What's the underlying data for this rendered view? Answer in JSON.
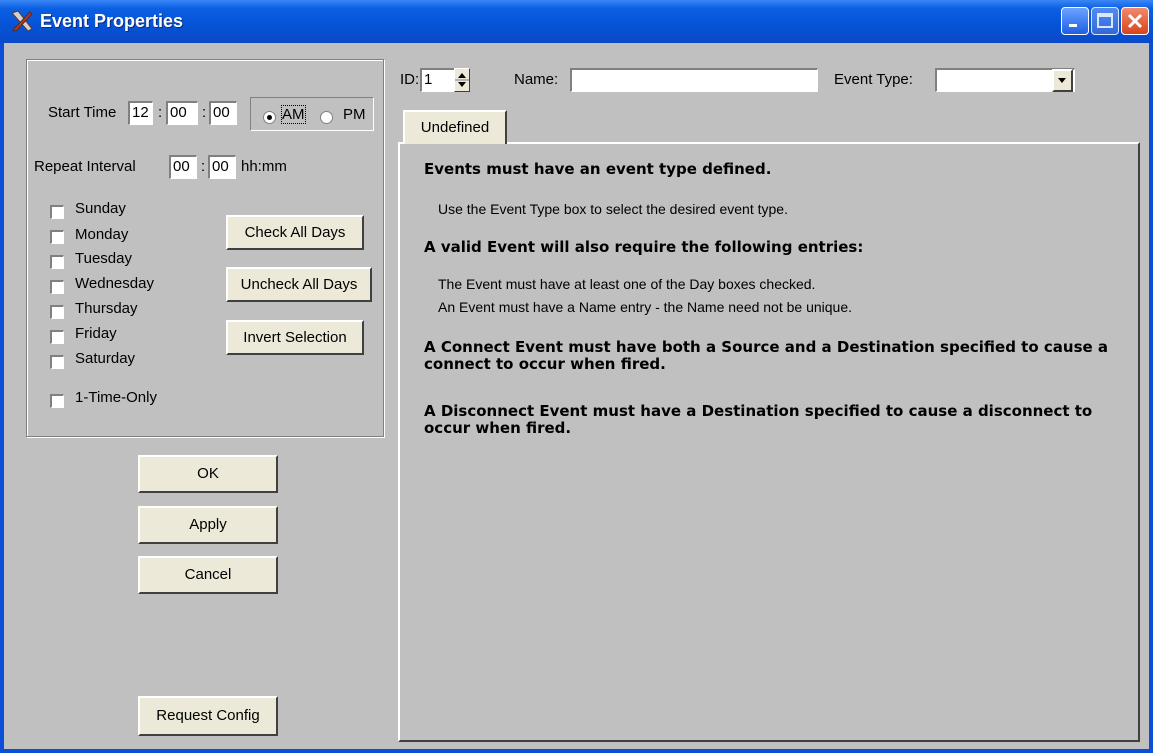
{
  "window": {
    "title": "Event Properties"
  },
  "left": {
    "start_time": {
      "label": "Start Time",
      "hour": "12",
      "minute": "00",
      "second": "00",
      "sep": ":"
    },
    "ampm": {
      "am": "AM",
      "pm": "PM",
      "selected": "AM"
    },
    "repeat": {
      "label": "Repeat Interval",
      "hours": "00",
      "minutes": "00",
      "sep": ":",
      "unit": "hh:mm"
    },
    "days": [
      {
        "label": "Sunday",
        "checked": false
      },
      {
        "label": "Monday",
        "checked": false
      },
      {
        "label": "Tuesday",
        "checked": false
      },
      {
        "label": "Wednesday",
        "checked": false
      },
      {
        "label": "Thursday",
        "checked": false
      },
      {
        "label": "Friday",
        "checked": false
      },
      {
        "label": "Saturday",
        "checked": false
      }
    ],
    "one_time": {
      "label": "1-Time-Only",
      "checked": false
    },
    "buttons": {
      "check_all": "Check All Days",
      "uncheck_all": "Uncheck All Days",
      "invert": "Invert Selection"
    }
  },
  "actions": {
    "ok": "OK",
    "apply": "Apply",
    "cancel": "Cancel",
    "request_config": "Request Config"
  },
  "top": {
    "id_label": "ID:",
    "id_value": "1",
    "name_label": "Name:",
    "name_value": "",
    "type_label": "Event Type:",
    "type_value": ""
  },
  "tab": {
    "label": "Undefined",
    "lines": [
      "Events must have an event type defined.",
      "Use the Event Type box to select the desired event type.",
      "A valid Event will also require the following entries:",
      "The Event must have at least one of the Day boxes checked.",
      "An Event must have a Name entry - the Name need not be unique.",
      "A Connect Event must have both a Source and a Destination specified to cause a connect to occur when fired.",
      "A Disconnect Event must have a Destination specified to cause a disconnect to occur when fired."
    ]
  }
}
